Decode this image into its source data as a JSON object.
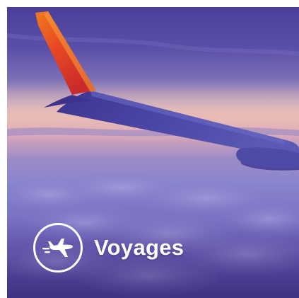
{
  "tile": {
    "title": "Voyages",
    "icon": "airplane-icon",
    "colors": {
      "sky_top": "#4a3e9a",
      "sky_horizon": "#e3b3b6",
      "clouds": "#7a72c4",
      "wing": "#4b47a3",
      "winglet_red": "#e23a2b",
      "winglet_orange": "#f07a1f",
      "text": "#ffffff"
    }
  }
}
